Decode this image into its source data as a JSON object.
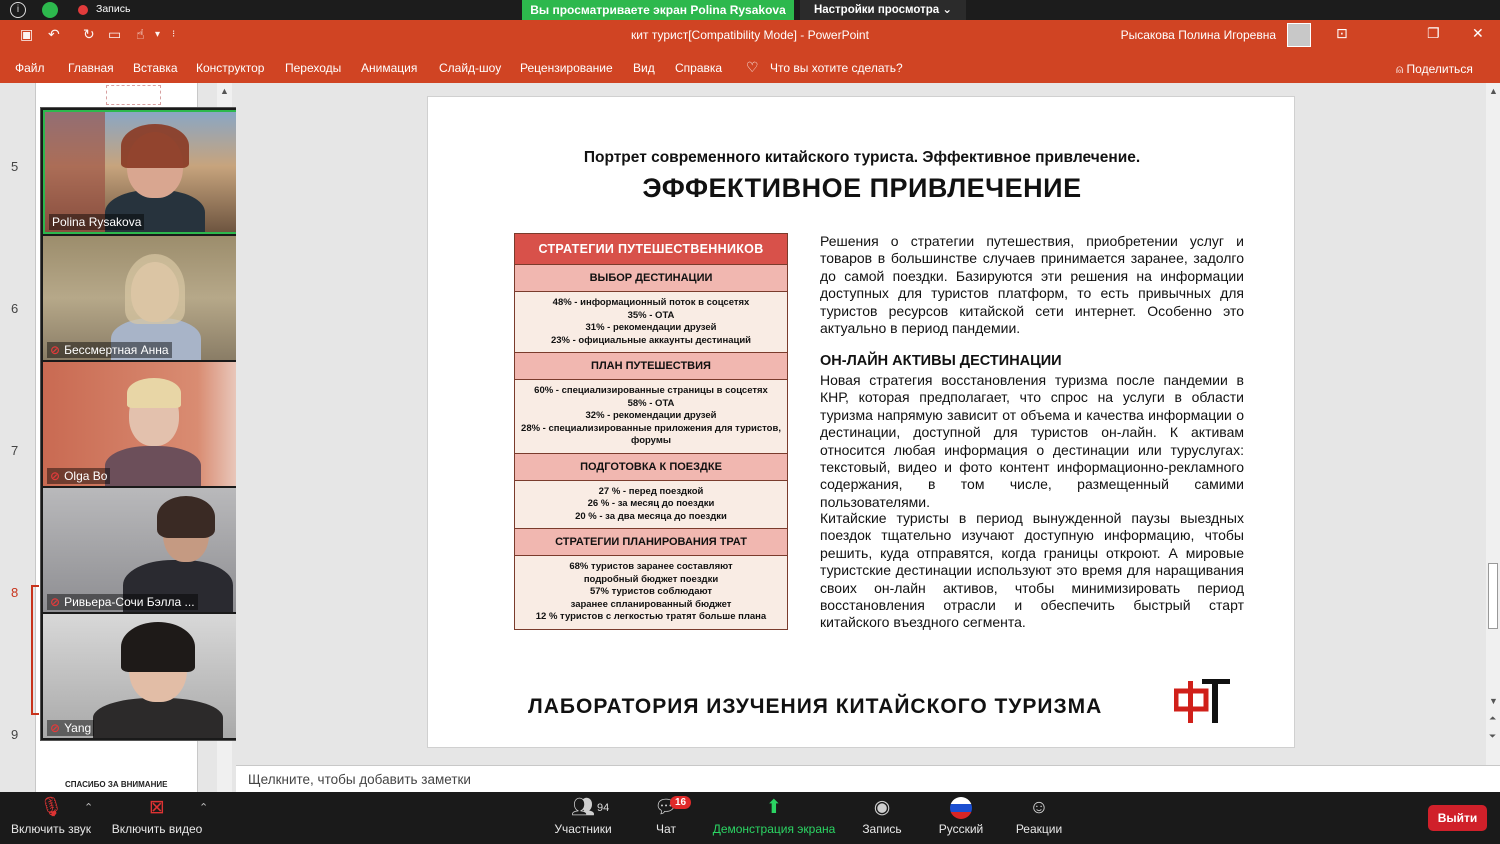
{
  "zoom_top": {
    "recording_label": "Запись",
    "sharing_banner": "Вы просматриваете экран Polina Rysakova",
    "view_options": "Настройки просмотра ⌄"
  },
  "ppt": {
    "doc_title": "кит турист[Compatibility Mode]  -  PowerPoint",
    "user_name": "Рысакова Полина Игоревна",
    "tabs": [
      "Файл",
      "Главная",
      "Вставка",
      "Конструктор",
      "Переходы",
      "Анимация",
      "Слайд-шоу",
      "Рецензирование",
      "Вид",
      "Справка",
      "Что вы хотите сделать?"
    ],
    "share": "Поделиться"
  },
  "thumbnails": {
    "slide_numbers": [
      "5",
      "6",
      "7",
      "8",
      "9"
    ],
    "last_thumb_text": "СПАСИБО ЗА ВНИМАНИЕ"
  },
  "participants": [
    {
      "name": "Polina Rysakova",
      "muted": false
    },
    {
      "name": "Бессмертная Анна",
      "muted": true
    },
    {
      "name": "Olga Bo",
      "muted": true
    },
    {
      "name": "Ривьера-Сочи Бэлла ...",
      "muted": true
    },
    {
      "name": "Yang",
      "muted": true
    }
  ],
  "slide": {
    "subtitle": "Портрет современного китайского туриста. Эффективное привлечение.",
    "title": "ЭФФЕКТИВНОЕ ПРИВЛЕЧЕНИЕ",
    "table": {
      "header": "СТРАТЕГИИ ПУТЕШЕСТВЕННИКОВ",
      "sections": [
        {
          "heading": "ВЫБОР ДЕСТИНАЦИИ",
          "lines": [
            "48% - информационный поток в соцсетях",
            "35% - OTA",
            "31% - рекомендации друзей",
            "23% - официальные аккаунты дестинаций"
          ]
        },
        {
          "heading": "ПЛАН ПУТЕШЕСТВИЯ",
          "lines": [
            "60% - специализированные страницы в соцсетях",
            "58% - OTA",
            "32% - рекомендации друзей",
            "28% - специализированные приложения для туристов, форумы"
          ]
        },
        {
          "heading": "ПОДГОТОВКА К ПОЕЗДКЕ",
          "lines": [
            "27 % - перед поездкой",
            "26 % - за месяц до поездки",
            "20 % - за два месяца до поездки"
          ]
        },
        {
          "heading": "СТРАТЕГИИ ПЛАНИРОВАНИЯ ТРАТ",
          "lines": [
            "68% туристов заранее составляют",
            "подробный бюджет поездки",
            "57% туристов соблюдают",
            "заранее спланированный бюджет",
            "12 % туристов с легкостью тратят больше плана"
          ]
        }
      ]
    },
    "para1": "Решения о стратегии путешествия, приобретении услуг и товаров в большинстве случаев принимается заранее, задолго до самой поездки. Базируются эти решения на информации доступных для туристов платформ, то есть привычных для туристов ресурсов китайской сети интернет. Особенно это актуально в период пандемии.",
    "online_heading": "ОН-ЛАЙН АКТИВЫ ДЕСТИНАЦИИ",
    "para2": "Новая стратегия восстановления туризма после пандемии в КНР, которая предполагает, что спрос на услуги в области туризма напрямую зависит от объема и качества информации о дестинации, доступной для туристов он-лайн. К активам относится любая информация о дестинации или туруслугах: текстовый, видео и фото контент информационно-рекламного содержания, в том числе, размещенный самими пользователями.",
    "para3": "Китайские туристы в период вынужденной паузы выездных поездок тщательно изучают доступную информацию, чтобы решить, куда отправятся, когда границы откроют. А мировые туристские дестинации используют это время для наращивания своих он-лайн активов, чтобы минимизировать период восстановления отрасли и обеспечить быстрый старт китайского въездного сегмента.",
    "footer": "ЛАБОРАТОРИЯ ИЗУЧЕНИЯ КИТАЙСКОГО ТУРИЗМА"
  },
  "notes_placeholder": "Щелкните, чтобы добавить заметки",
  "zoom_bar": {
    "mute": "Включить звук",
    "video": "Включить видео",
    "participants": "Участники",
    "participants_count": "94",
    "chat": "Чат",
    "chat_badge": "16",
    "share_screen": "Демонстрация экрана",
    "record": "Запись",
    "language": "Русский",
    "reactions": "Реакции",
    "leave": "Выйти"
  }
}
